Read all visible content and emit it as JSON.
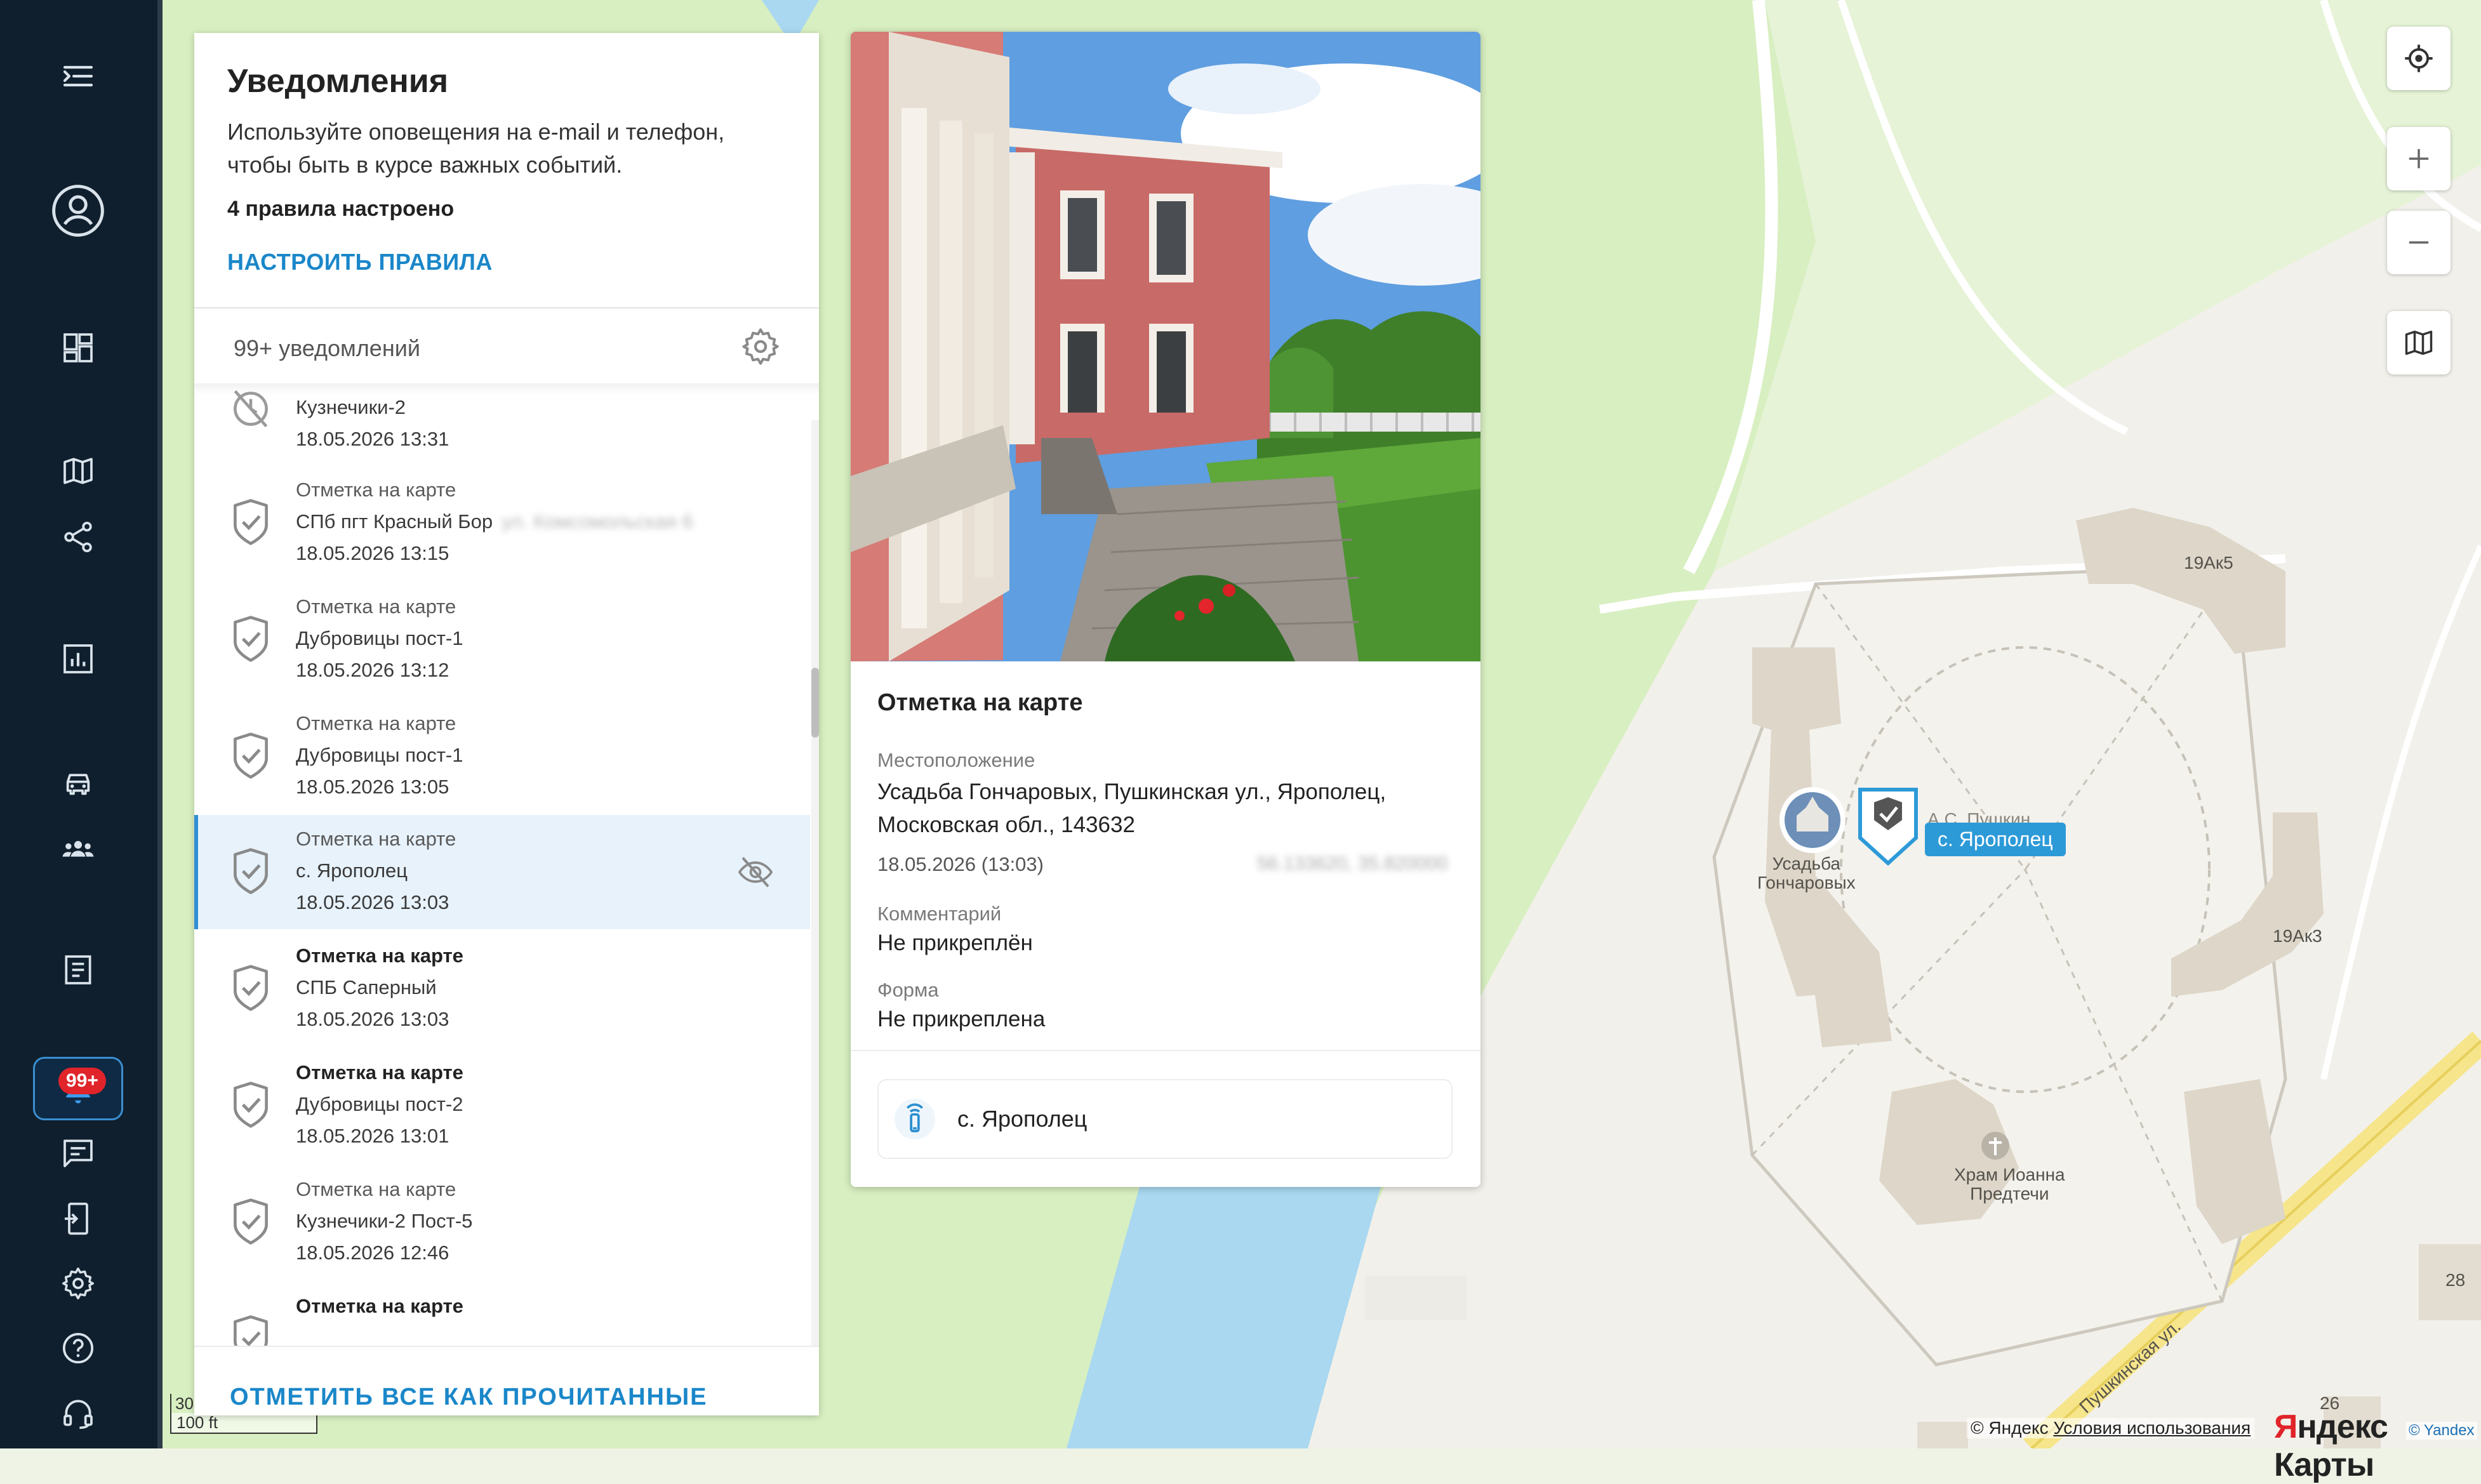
{
  "sidebar": {
    "items": [
      {
        "name": "menu-collapse",
        "icon": "menu-collapse-icon"
      },
      {
        "name": "profile",
        "icon": "user-circle-icon"
      },
      {
        "name": "dashboard",
        "icon": "dashboard-icon"
      },
      {
        "name": "map",
        "icon": "map-icon"
      },
      {
        "name": "share",
        "icon": "share-icon"
      },
      {
        "name": "reports",
        "icon": "chart-icon"
      },
      {
        "name": "vehicles",
        "icon": "car-icon"
      },
      {
        "name": "employees",
        "icon": "group-icon"
      },
      {
        "name": "tasks",
        "icon": "document-icon"
      },
      {
        "name": "notifications",
        "icon": "bell-icon",
        "badge": "99+",
        "active": true
      },
      {
        "name": "messages",
        "icon": "chat-icon"
      },
      {
        "name": "devices",
        "icon": "device-icon"
      },
      {
        "name": "settings",
        "icon": "gear-icon"
      },
      {
        "name": "help",
        "icon": "help-icon"
      },
      {
        "name": "support",
        "icon": "headset-icon"
      }
    ]
  },
  "notifications": {
    "title": "Уведомления",
    "description": "Используйте оповещения на e-mail и телефон, чтобы быть в курсе важных событий.",
    "rules_count": "4 правила настроено",
    "configure_label": "НАСТРОИТЬ ПРАВИЛА",
    "count_label": "99+ уведомлений",
    "mark_all_label": "ОТМЕТИТЬ ВСЕ КАК ПРОЧИТАННЫЕ",
    "items": [
      {
        "type": "",
        "place": "Кузнечики-2",
        "place_extra": "",
        "time": "18.05.2026 13:31",
        "icon": "clock-off-icon",
        "unread": false,
        "selected": false
      },
      {
        "type": "Отметка на карте",
        "place": "СПб пгт Красный Бор",
        "place_extra": "ул. Комсомольская 6",
        "time": "18.05.2026 13:15",
        "icon": "shield-check-icon",
        "unread": false,
        "selected": false
      },
      {
        "type": "Отметка на карте",
        "place": "Дубровицы пост-1",
        "place_extra": "",
        "time": "18.05.2026 13:12",
        "icon": "shield-check-icon",
        "unread": false,
        "selected": false
      },
      {
        "type": "Отметка на карте",
        "place": "Дубровицы пост-1",
        "place_extra": "",
        "time": "18.05.2026 13:05",
        "icon": "shield-check-icon",
        "unread": false,
        "selected": false
      },
      {
        "type": "Отметка на карте",
        "place": "с. Ярополец",
        "place_extra": "",
        "time": "18.05.2026 13:03",
        "icon": "shield-check-icon",
        "unread": false,
        "selected": true
      },
      {
        "type": "Отметка на карте",
        "place": "СПБ Саперный",
        "place_extra": "",
        "time": "18.05.2026 13:03",
        "icon": "shield-check-icon",
        "unread": true,
        "selected": false
      },
      {
        "type": "Отметка на карте",
        "place": "Дубровицы пост-2",
        "place_extra": "",
        "time": "18.05.2026 13:01",
        "icon": "shield-check-icon",
        "unread": true,
        "selected": false
      },
      {
        "type": "Отметка на карте",
        "place": "Кузнечики-2 Пост-5",
        "place_extra": "",
        "time": "18.05.2026 12:46",
        "icon": "shield-check-icon",
        "unread": false,
        "selected": false
      },
      {
        "type": "Отметка на карте",
        "place": "",
        "place_extra": "",
        "time": "",
        "icon": "shield-check-icon",
        "unread": true,
        "selected": false
      }
    ]
  },
  "detail": {
    "title": "Отметка на карте",
    "location_label": "Местоположение",
    "location_value": "Усадьба Гончаровых, Пушкинская ул., Ярополец, Московская обл., 143632",
    "datetime": "18.05.2026 (13:03)",
    "coords": "56.133620, 35.820000",
    "comment_label": "Комментарий",
    "comment_value": "Не прикреплён",
    "form_label": "Форма",
    "form_value": "Не прикреплена",
    "tracker_label": "с. Ярополец"
  },
  "map": {
    "tooltip": "с. Ярополец",
    "poi_estate": "Усадьба\nГончаровых",
    "poi_church": "Храм Иоанна\nПредтечи",
    "poi_pushkin": "А.С. Пушкин",
    "building_1": "19Ак5",
    "building_2": "19Ак3",
    "building_3": "28",
    "building_4": "26",
    "street": "Пушкинская ул.",
    "scale_top": "30",
    "scale_bottom": "100 ft",
    "copyright": "© Яндекс",
    "terms": "Условия использования",
    "logo_red": "Я",
    "logo_rest": "ндекс Карты",
    "logo_small": "© Yandex",
    "controls": [
      "locate-icon",
      "zoom-in-icon",
      "zoom-out-icon",
      "layers-icon"
    ]
  },
  "colors": {
    "sidebar_bg": "#0f1f2e",
    "accent": "#1a87c9",
    "selected_row": "#e7f2fb",
    "badge": "#e0242a",
    "park": "#d5efbf",
    "water": "#a9d8f0"
  }
}
